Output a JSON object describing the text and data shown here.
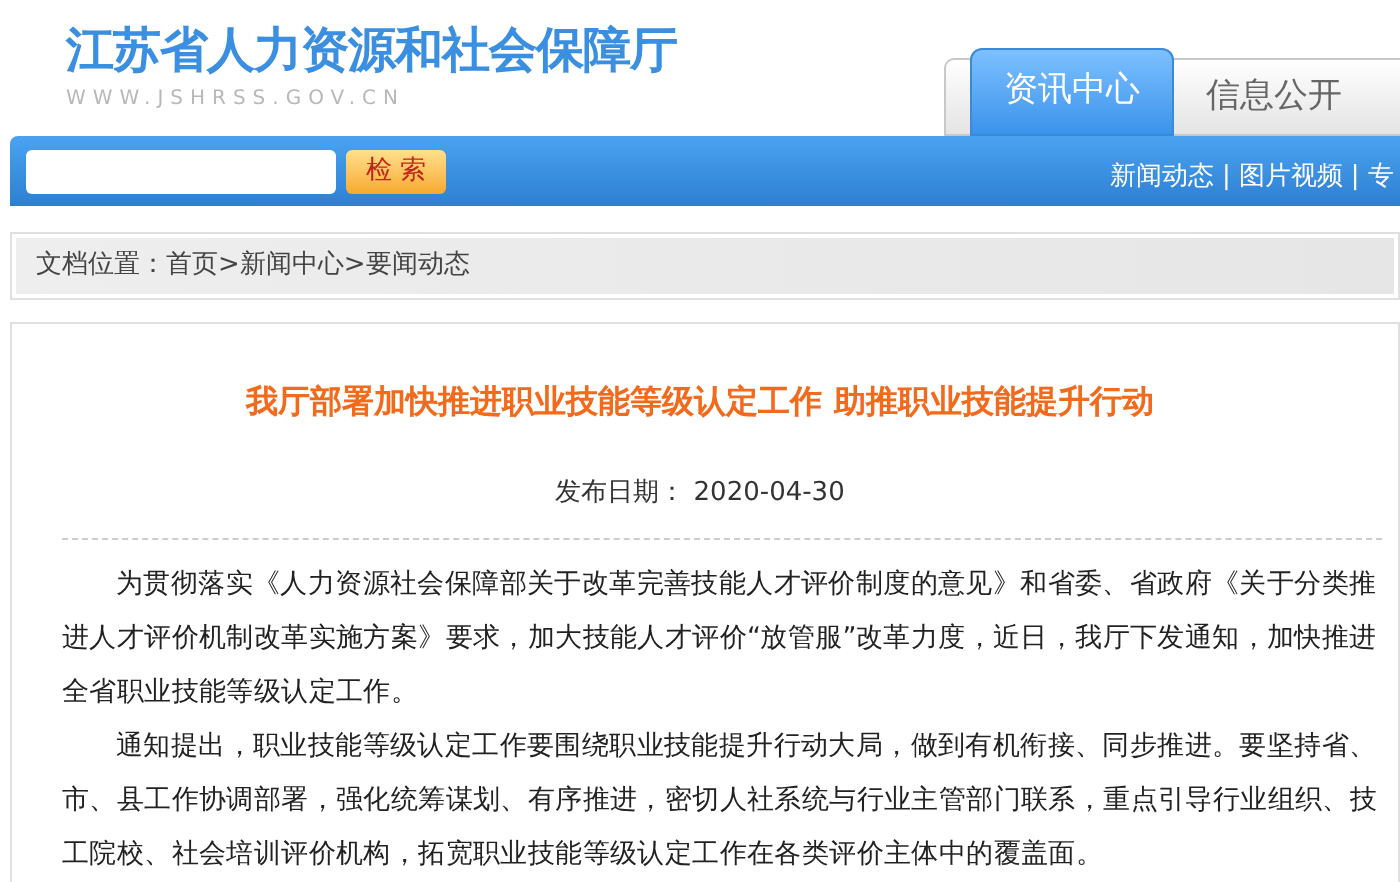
{
  "site": {
    "title": "江苏省人力资源和社会保障厅",
    "url": "WWW.JSHRSS.GOV.CN"
  },
  "tabs": [
    {
      "label": "资讯中心",
      "selected": true
    },
    {
      "label": "信息公开",
      "selected": false
    }
  ],
  "search": {
    "button": "检 索"
  },
  "nav": {
    "separator": "|",
    "links": [
      "新闻动态",
      "图片视频",
      "专"
    ]
  },
  "breadcrumb": "文档位置：首页>新闻中心>要闻动态",
  "article": {
    "title": "我厅部署加快推进职业技能等级认定工作 助推职业技能提升行动",
    "date": "发布日期： 2020-04-30",
    "paragraphs": [
      "为贯彻落实《人力资源社会保障部关于改革完善技能人才评价制度的意见》和省委、省政府《关于分类推进人才评价机制改革实施方案》要求，加大技能人才评价“放管服”改革力度，近日，我厅下发通知，加快推进全省职业技能等级认定工作。",
      "通知提出，职业技能等级认定工作要围绕职业技能提升行动大局，做到有机衔接、同步推进。要坚持省、市、县工作协调部署，强化统筹谋划、有序推进，密切人社系统与行业主管部门联系，重点引导行业组织、技工院校、社会培训评价机构，拓宽职业技能等级认定工作在各类评价主体中的覆盖面。"
    ]
  }
}
